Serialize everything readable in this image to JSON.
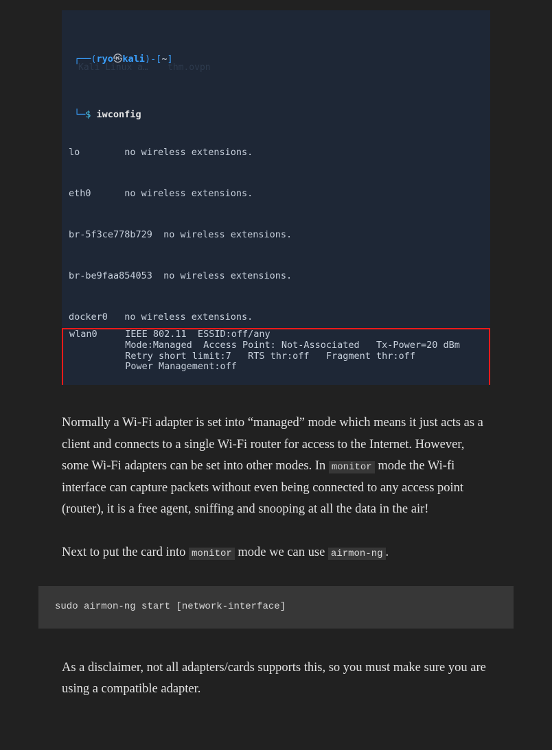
{
  "terminal": {
    "prompt": {
      "paren_open": "(",
      "user": "ryo",
      "skull": "㉿",
      "host": "kali",
      "paren_close": ")",
      "dash": "-",
      "brack_open": "[",
      "tilde": "~",
      "brack_close": "]",
      "dollar": "$",
      "command": "iwconfig",
      "corner_glyph": "┌──",
      "branch_glyph": "└─"
    },
    "lines": [
      "lo        no wireless extensions.",
      "eth0      no wireless extensions.",
      "br-5f3ce778b729  no wireless extensions.",
      "br-be9faa854053  no wireless extensions.",
      "docker0   no wireless extensions."
    ],
    "wlan_block": "wlan0     IEEE 802.11  ESSID:off/any\n          Mode:Managed  Access Point: Not-Associated   Tx-Power=20 dBm\n          Retry short limit:7   RTS thr:off   Fragment thr:off\n          Power Management:off\n          ",
    "ghost_labels": {
      "tab1": "Kali Linux a…",
      "tab2": "thm.ovpn"
    }
  },
  "paragraphs": {
    "p1_a": "Normally a Wi-Fi adapter is set into “managed” mode which means it just acts as a client and connects to a single Wi-Fi router for access to the Internet. However, some Wi-Fi adapters can be set into other modes. In ",
    "p1_code": "monitor",
    "p1_b": " mode the Wi-fi interface can capture packets without even being connected to any access point (router), it is a free agent, sniffing and snooping at all the data in the air!",
    "p2_a": "Next to put the card into ",
    "p2_code1": "monitor",
    "p2_b": " mode we can use ",
    "p2_code2": "airmon-ng",
    "p2_c": ".",
    "p3": "As a disclaimer, not all adapters/cards supports this, so you must make sure you are using a compatible adapter."
  },
  "code_block": "sudo airmon-ng start [network-interface]"
}
